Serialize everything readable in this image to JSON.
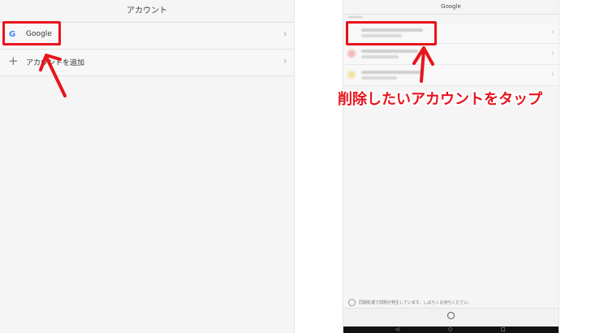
{
  "left": {
    "header_title": "アカウント",
    "rows": [
      {
        "label": "Google",
        "icon": "google-g-icon"
      },
      {
        "label": "アカウントを追加",
        "icon": "plus-icon"
      }
    ]
  },
  "right": {
    "header_title": "Google",
    "note": "同期処理で問題が発生しています。しばらくお待ちください。",
    "bottom_label": "すべて同期"
  },
  "annotation": {
    "caption": "削除したいアカウントをタップ",
    "color": "#e8141c"
  },
  "icons": {
    "google": "G",
    "plus": "+",
    "chevron": "›",
    "nav_back": "◁",
    "nav_home": "○",
    "nav_recent": "□"
  }
}
